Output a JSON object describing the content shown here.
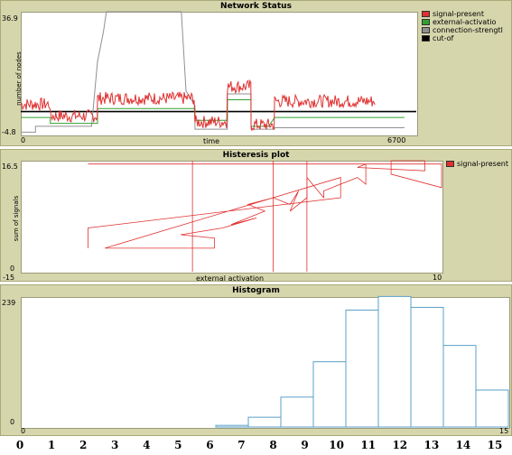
{
  "colors": {
    "panel_bg": "#d6d6ad",
    "signal": "#e03030",
    "external": "#30a030",
    "connection": "#909090",
    "cutoff": "#000000",
    "histogram": "#5aa0c8"
  },
  "chart_data": [
    {
      "type": "line",
      "title": "Network Status",
      "xlabel": "time",
      "ylabel": "number of nodes",
      "xlim": [
        0,
        6700
      ],
      "ylim": [
        -4.8,
        36.9
      ],
      "x_ticks": [
        "0",
        "6700"
      ],
      "y_ticks": [
        "36.9",
        "-4.8"
      ],
      "legend": [
        "signal-present",
        "external-activation",
        "connection-strength",
        "cut-off"
      ],
      "legend_display": [
        "signal-present",
        "external-activatio",
        "connection-strengtl",
        "cut-of"
      ],
      "series": [
        {
          "name": "signal-present",
          "segments": [
            [
              0,
              5.5
            ],
            [
              500,
              5.5
            ],
            [
              500,
              1.5
            ],
            [
              1300,
              1.5
            ],
            [
              1300,
              7.5
            ],
            [
              2950,
              7.5
            ],
            [
              2950,
              -0.5
            ],
            [
              3500,
              -0.5
            ],
            [
              3500,
              11.5
            ],
            [
              3900,
              11.5
            ],
            [
              3900,
              -1.5
            ],
            [
              4200,
              -1.5
            ],
            [
              4200,
              -1.5
            ],
            [
              4300,
              -1.5
            ],
            [
              4300,
              6.5
            ],
            [
              6000,
              6.5
            ]
          ],
          "noise": 2.2
        },
        {
          "name": "external-activation",
          "points": [
            [
              0,
              1
            ],
            [
              500,
              1
            ],
            [
              500,
              -1
            ],
            [
              1300,
              -1
            ],
            [
              1300,
              4
            ],
            [
              2950,
              4
            ],
            [
              2950,
              0
            ],
            [
              3500,
              0
            ],
            [
              3500,
              7
            ],
            [
              3900,
              7
            ],
            [
              3900,
              -2
            ],
            [
              4200,
              -2
            ],
            [
              4300,
              1
            ],
            [
              6500,
              1
            ]
          ]
        },
        {
          "name": "connection-strength",
          "points": [
            [
              0,
              -4
            ],
            [
              250,
              -4
            ],
            [
              250,
              -2
            ],
            [
              1200,
              -2
            ],
            [
              1300,
              20
            ],
            [
              1400,
              30
            ],
            [
              1450,
              36.9
            ],
            [
              2720,
              36.9
            ],
            [
              2800,
              10
            ],
            [
              2950,
              5
            ],
            [
              2950,
              -3
            ],
            [
              3500,
              -3
            ],
            [
              3500,
              9
            ],
            [
              3900,
              9
            ],
            [
              3900,
              -3
            ],
            [
              4300,
              -3
            ],
            [
              4300,
              -2.5
            ],
            [
              6500,
              -2.5
            ]
          ]
        },
        {
          "name": "cut-off",
          "points": [
            [
              0,
              3
            ],
            [
              6700,
              3
            ]
          ]
        }
      ]
    },
    {
      "type": "line",
      "title": "Histeresis plot",
      "xlabel": "external activation",
      "ylabel": "sum of signals",
      "xlim": [
        -15,
        10
      ],
      "ylim": [
        0,
        16.5
      ],
      "x_ticks": [
        "-15",
        "10"
      ],
      "y_ticks": [
        "16.5",
        "0"
      ],
      "legend": [
        "signal-present"
      ],
      "points": [
        [
          -11,
          3.5
        ],
        [
          -11,
          6.5
        ],
        [
          4,
          11
        ],
        [
          4,
          14
        ],
        [
          -10,
          3.5
        ],
        [
          -3.5,
          3.5
        ],
        [
          -3.5,
          5
        ],
        [
          -5.5,
          5.5
        ],
        [
          -3,
          6.5
        ],
        [
          -1,
          8
        ],
        [
          -2.5,
          7
        ],
        [
          -0.5,
          9
        ],
        [
          -1.5,
          10
        ],
        [
          0,
          11
        ],
        [
          1,
          10
        ],
        [
          1.5,
          12
        ],
        [
          1,
          9
        ],
        [
          2,
          11
        ],
        [
          2,
          14
        ],
        [
          3,
          11
        ],
        [
          3,
          12
        ],
        [
          5,
          14
        ],
        [
          5.5,
          13
        ],
        [
          5.5,
          16
        ],
        [
          5,
          15.5
        ],
        [
          9,
          15
        ],
        [
          9,
          16
        ],
        [
          9,
          17
        ],
        [
          7,
          16.5
        ],
        [
          7,
          14.5
        ],
        [
          10,
          12.5
        ],
        [
          10,
          16
        ],
        [
          -11,
          16
        ]
      ],
      "vlines": [
        -4.8,
        0,
        2
      ]
    },
    {
      "type": "bar",
      "title": "Histogram",
      "xlim": [
        0,
        15
      ],
      "ylim": [
        0,
        239
      ],
      "x_ticks": [
        "0",
        "15"
      ],
      "y_ticks": [
        "239",
        "0"
      ],
      "categories": [
        0,
        1,
        2,
        3,
        4,
        5,
        6,
        7,
        8,
        9,
        10,
        11,
        12,
        13,
        14
      ],
      "values": [
        0,
        0,
        0,
        0,
        0,
        0,
        3,
        18,
        55,
        120,
        215,
        240,
        220,
        150,
        68
      ]
    }
  ],
  "bottom_axis": [
    "0",
    "1",
    "2",
    "3",
    "4",
    "5",
    "6",
    "7",
    "8",
    "9",
    "10",
    "11",
    "12",
    "13",
    "14",
    "15"
  ]
}
